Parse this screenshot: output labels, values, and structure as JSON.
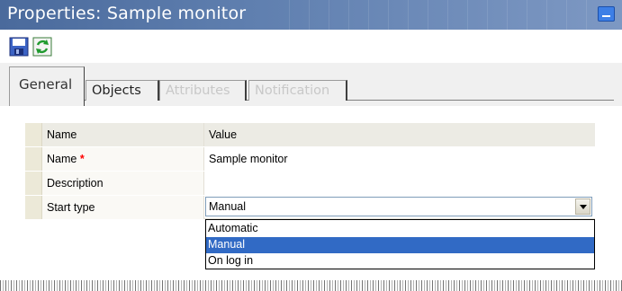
{
  "window": {
    "title": "Properties: Sample monitor"
  },
  "toolbar": {
    "save_icon": "save-icon",
    "refresh_icon": "refresh-icon"
  },
  "tabs": [
    {
      "label": "General",
      "state": "active"
    },
    {
      "label": "Objects",
      "state": "enabled"
    },
    {
      "label": "Attributes",
      "state": "disabled"
    },
    {
      "label": "Notification",
      "state": "disabled"
    }
  ],
  "grid": {
    "columns": [
      "Name",
      "Value"
    ],
    "rows": [
      {
        "name": "Name",
        "required_mark": "*",
        "value": "Sample monitor"
      },
      {
        "name": "Description",
        "value": ""
      },
      {
        "name": "Start type",
        "value": "Manual"
      }
    ]
  },
  "start_type_dropdown": {
    "selected": "Manual",
    "options": [
      "Automatic",
      "Manual",
      "On log in"
    ]
  },
  "colors": {
    "title_bar": "#5f7faf",
    "selection": "#316ac5",
    "required": "#ff0000"
  }
}
